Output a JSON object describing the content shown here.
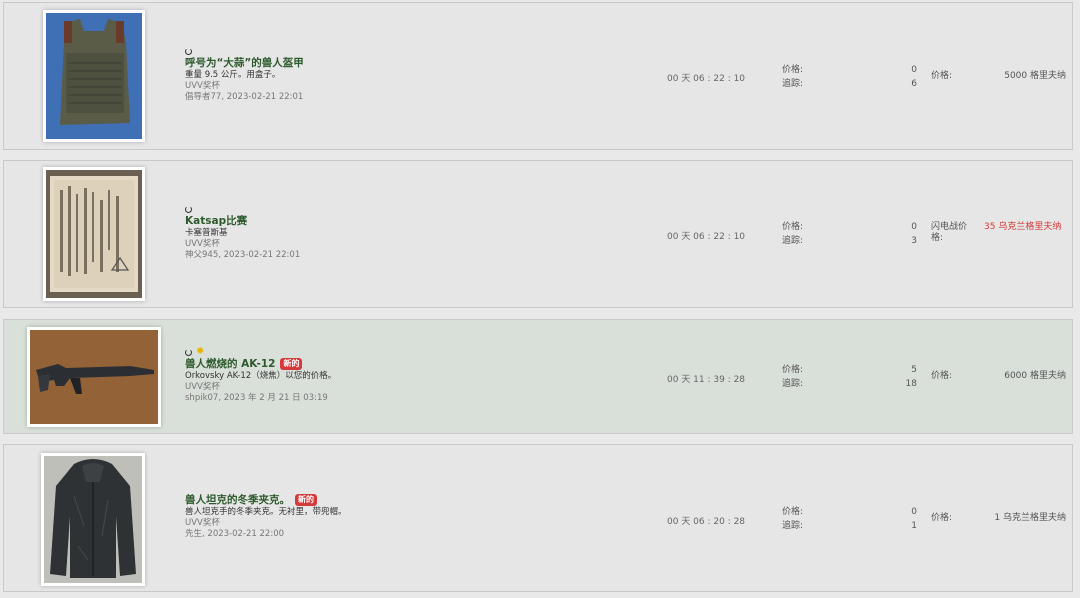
{
  "listings": [
    {
      "title": "呼号为“大蒜”的兽人盔甲",
      "is_new": false,
      "new_badge": "",
      "description": "重量 9.5 公斤。用盒子。",
      "category": "UVV奖杯",
      "author": "倡导者77",
      "date": ", 2023-02-21 22:01",
      "time_left": "00 天 06 : 22 : 10",
      "price_label": "价格:",
      "price_count": "0",
      "tracking_label": "追踪:",
      "tracking_count": "6",
      "buy_label": "价格:",
      "buy_value": "5000 格里夫纳",
      "buy_red": false
    },
    {
      "title": "Katsap比赛",
      "is_new": false,
      "new_badge": "",
      "description": "卡塞普斯基",
      "category": "UVV奖杯",
      "author": "神父945",
      "date": ", 2023-02-21 22:01",
      "time_left": "00 天 06 : 22 : 10",
      "price_label": "价格:",
      "price_count": "0",
      "tracking_label": "追踪:",
      "tracking_count": "3",
      "buy_label": "闪电战价格:",
      "buy_value": "35 乌克兰格里夫纳",
      "buy_red": true
    },
    {
      "title": "兽人燃烧的 AK-12",
      "is_new": true,
      "new_badge": "新的",
      "description": "Orkovsky AK-12（烧焦）以您的价格。",
      "category": "UVV奖杯",
      "author": "shpik07",
      "date": ", 2023 年 2 月 21 日 03:19",
      "time_left": "00 天 11 : 39 : 28",
      "price_label": "价格:",
      "price_count": "5",
      "tracking_label": "追踪:",
      "tracking_count": "18",
      "buy_label": "价格:",
      "buy_value": "6000 格里夫纳",
      "buy_red": false
    },
    {
      "title": "兽人坦克的冬季夹克。",
      "is_new": true,
      "new_badge": "新的",
      "description": "兽人坦克手的冬季夹克。无衬里，带兜帽。",
      "category": "UVV奖杯",
      "author": "先生",
      "date": ", 2023-02-21 22:00",
      "time_left": "00 天 06 : 20 : 28",
      "price_label": "价格:",
      "price_count": "0",
      "tracking_label": "追踪:",
      "tracking_count": "1",
      "buy_label": "价格:",
      "buy_value": "1 乌克兰格里夫纳",
      "buy_red": false
    }
  ]
}
